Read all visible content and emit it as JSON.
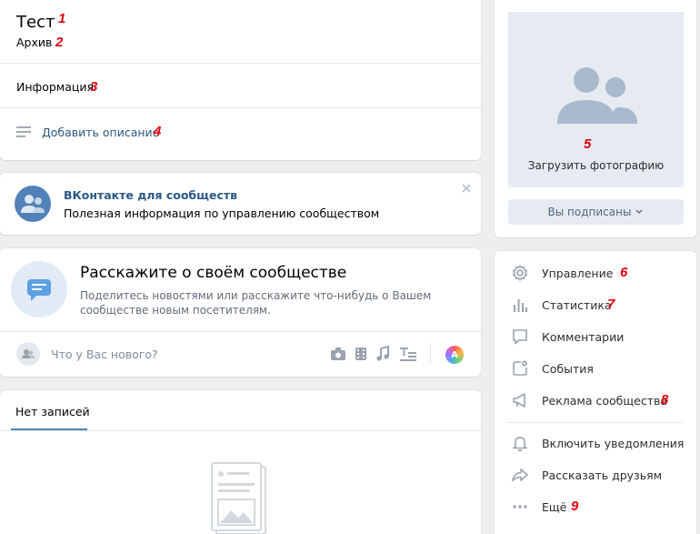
{
  "header": {
    "title": "Тест",
    "subtitle": "Архив",
    "info_label": "Информация",
    "add_description": "Добавить описание"
  },
  "annotations": [
    "1",
    "2",
    "3",
    "4",
    "5",
    "6",
    "7",
    "8",
    "9"
  ],
  "promo": {
    "title": "ВКонтакте для сообществ",
    "text": "Полезная информация по управлению сообществом"
  },
  "about": {
    "title": "Расскажите о своём сообществе",
    "text_line1": "Поделитесь новостями или расскажите что-нибудь о Вашем",
    "text_line2": "сообществе новым посетителям."
  },
  "composer": {
    "placeholder": "Что у Вас нового?",
    "icons": [
      "camera-icon",
      "video-icon",
      "music-icon",
      "article-icon",
      "avatar-a-icon"
    ],
    "avatar_letter": "А"
  },
  "wall": {
    "tab": "Нет записей"
  },
  "photo": {
    "upload_label": "Загрузить фотографию",
    "subscribed_label": "Вы подписаны"
  },
  "menu": {
    "items": [
      {
        "label": "Управление",
        "icon": "gear-icon"
      },
      {
        "label": "Статистика",
        "icon": "stats-icon"
      },
      {
        "label": "Комментарии",
        "icon": "comment-icon"
      },
      {
        "label": "События",
        "icon": "event-icon"
      },
      {
        "label": "Реклама сообщества",
        "icon": "megaphone-icon"
      },
      {
        "label": "Включить уведомления",
        "icon": "bell-icon"
      },
      {
        "label": "Рассказать друзьям",
        "icon": "share-icon"
      },
      {
        "label": "Ещё",
        "icon": "more-icon"
      }
    ]
  },
  "colors": {
    "accent": "#2a5885",
    "annotation": "#e3000f",
    "background": "#edeef0"
  }
}
